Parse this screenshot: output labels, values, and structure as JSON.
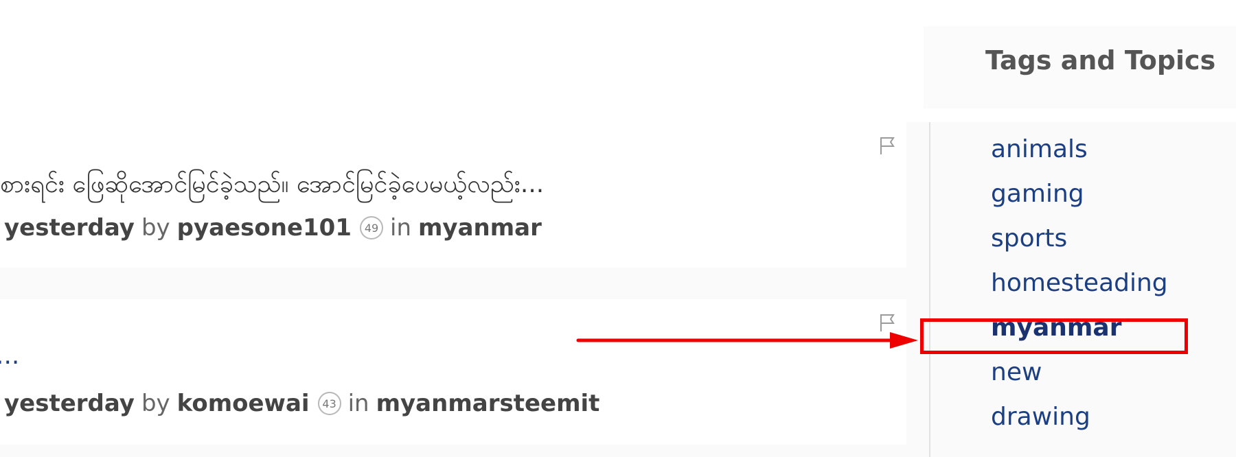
{
  "feed": {
    "posts": [
      {
        "title": "စားရင်း ဖြေဆိုအောင်မြင်ခဲ့သည်။ အောင်မြင်ခဲ့ပေမယ့်လည်း...",
        "time": "yesterday",
        "by_label": "by",
        "author": "pyaesone101",
        "reputation": "49",
        "in_label": "in",
        "category": "myanmar"
      },
      {
        "title": "...",
        "time": "yesterday",
        "by_label": "by",
        "author": "komoewai",
        "reputation": "43",
        "in_label": "in",
        "category": "myanmarsteemit"
      }
    ]
  },
  "sidebar": {
    "title": "Tags and Topics",
    "tags": [
      {
        "label": "animals",
        "active": false
      },
      {
        "label": "gaming",
        "active": false
      },
      {
        "label": "sports",
        "active": false
      },
      {
        "label": "homesteading",
        "active": false
      },
      {
        "label": "myanmar",
        "active": true
      },
      {
        "label": "new",
        "active": false
      },
      {
        "label": "drawing",
        "active": false
      }
    ]
  },
  "colors": {
    "link": "#1b3f82",
    "annotation": "#ee0000",
    "meta_text": "#555555"
  },
  "icons": {
    "flag": "flag-icon"
  }
}
